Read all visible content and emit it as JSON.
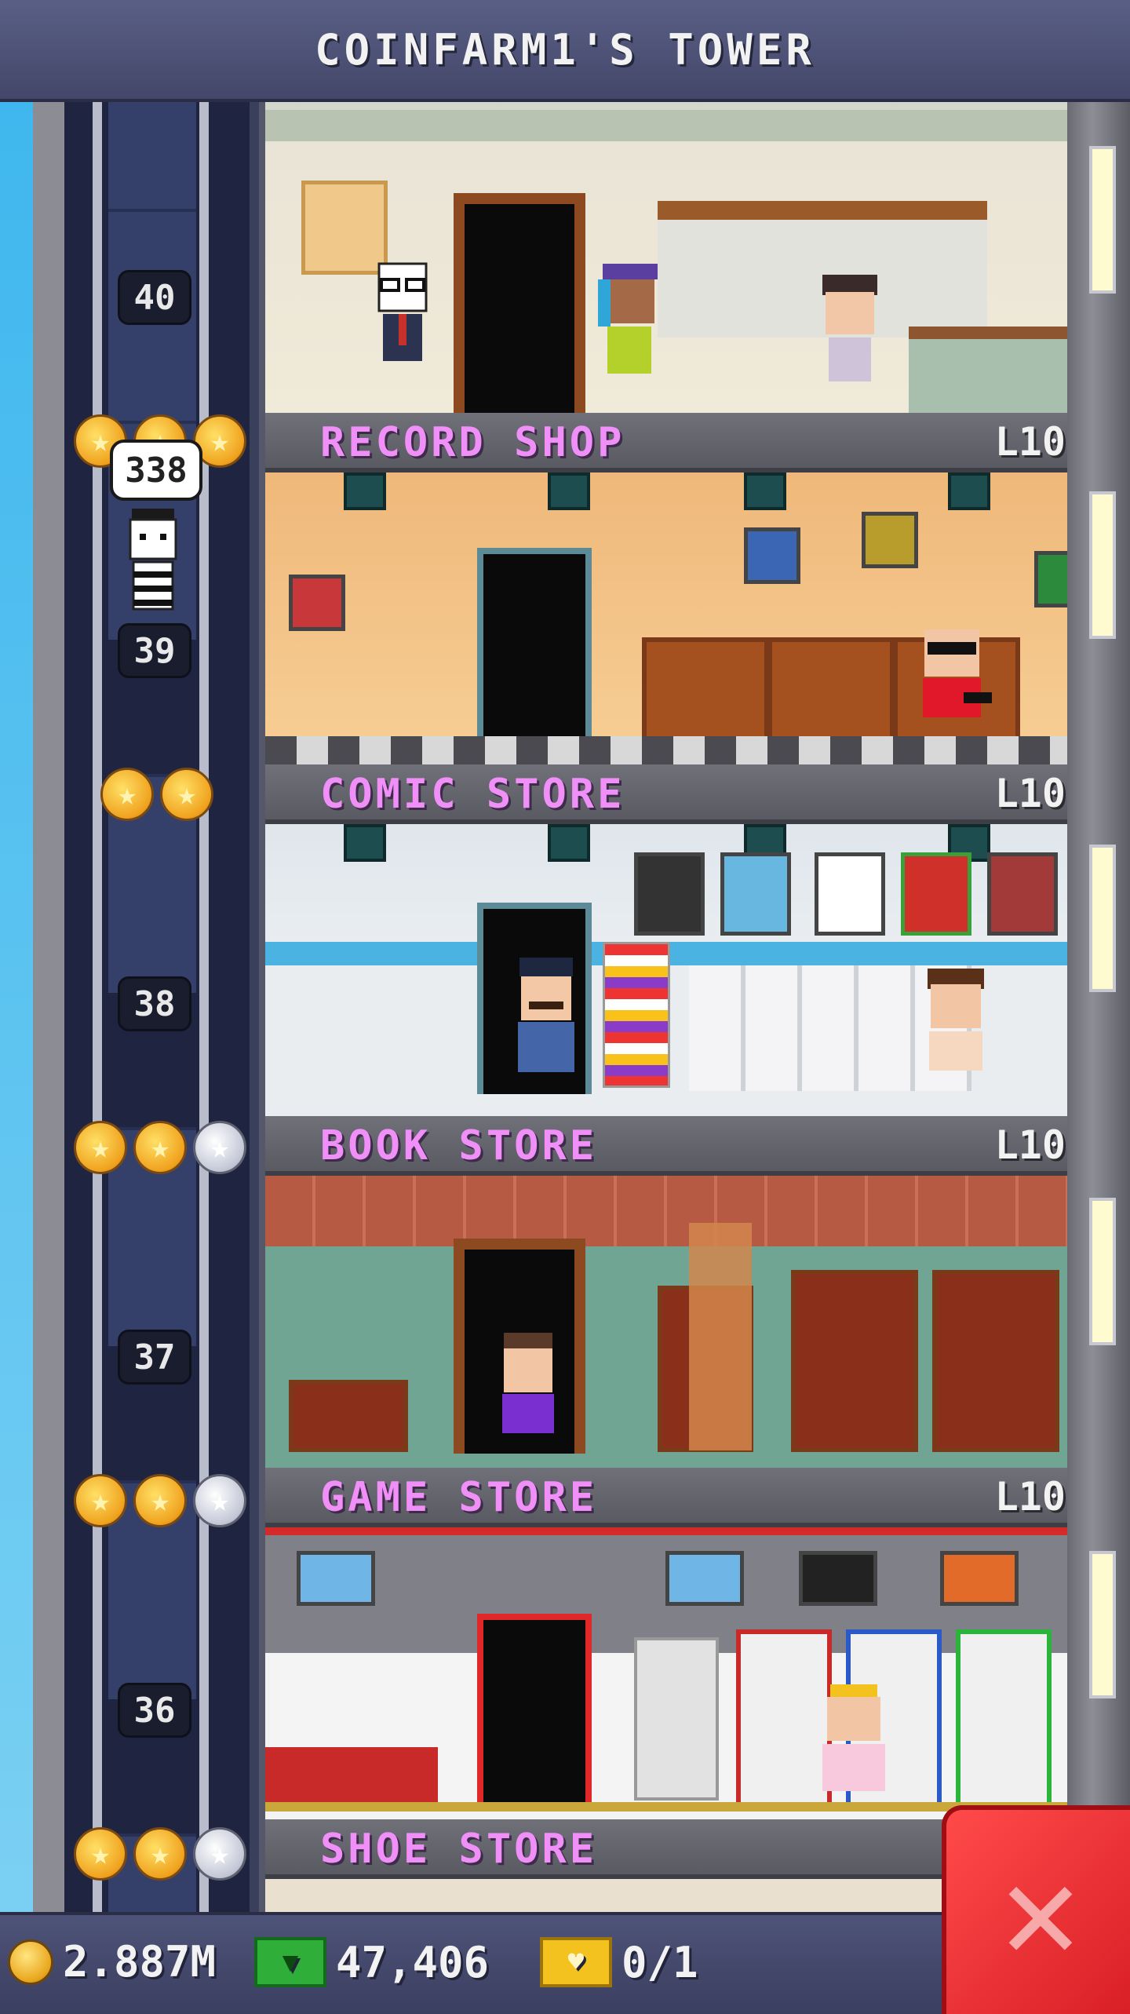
{
  "header": {
    "title": "COINFARM1'S TOWER"
  },
  "elevator": {
    "floor_labels": [
      "40",
      "39",
      "38",
      "37",
      "36"
    ],
    "passenger_count": "338"
  },
  "floors": [
    {
      "name": "RECORD SHOP",
      "level": "L10",
      "stars": [
        "gold",
        "gold",
        "gold"
      ]
    },
    {
      "name": "COMIC STORE",
      "level": "L10",
      "stars": [
        "gold",
        "gold"
      ]
    },
    {
      "name": "BOOK STORE",
      "level": "L10",
      "stars": [
        "gold",
        "gold",
        "silver"
      ]
    },
    {
      "name": "GAME STORE",
      "level": "L10",
      "stars": [
        "gold",
        "gold",
        "silver"
      ]
    },
    {
      "name": "SHOE STORE",
      "level": "",
      "stars": [
        "gold",
        "gold",
        "silver"
      ]
    }
  ],
  "footer": {
    "coins": "2.887M",
    "bux": "47,406",
    "tickets": "0/1"
  },
  "colors": {
    "floor_name": "#ef8ff7",
    "close_button": "#e8262c",
    "coin": "#f0a21e",
    "bux": "#2fae3a"
  }
}
